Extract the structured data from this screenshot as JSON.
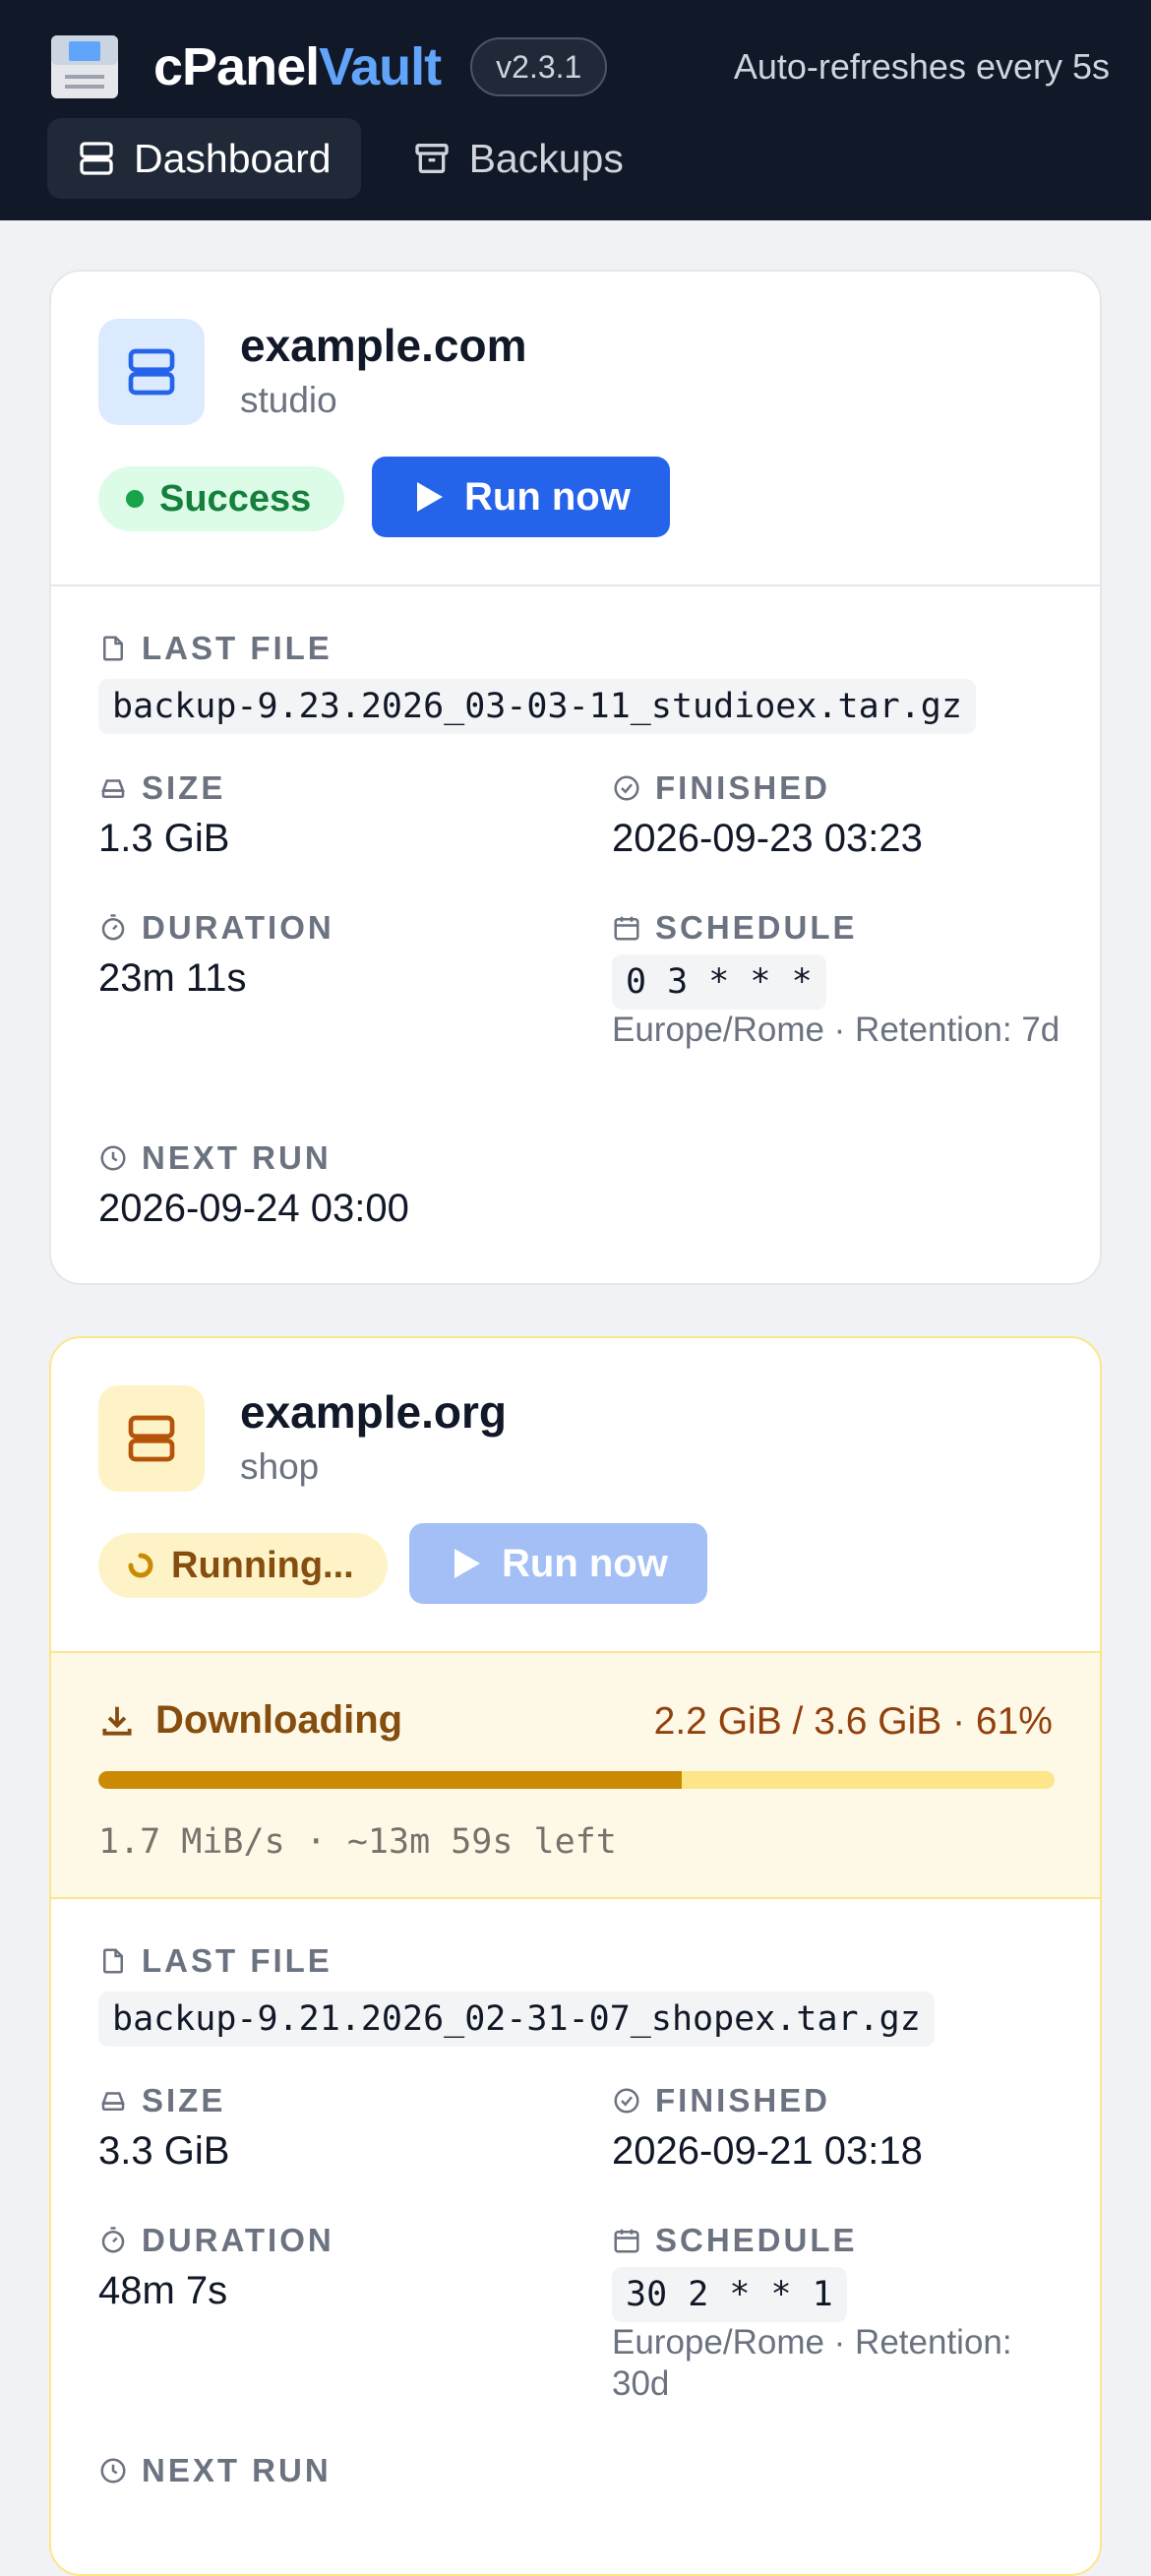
{
  "header": {
    "brand_primary": "cPanel",
    "brand_accent": "Vault",
    "version": "v2.3.1",
    "auto_refresh": "Auto-refreshes every 5s",
    "tabs": [
      {
        "label": "Dashboard",
        "icon": "server-stack-icon",
        "active": true
      },
      {
        "label": "Backups",
        "icon": "archive-box-icon",
        "active": false
      }
    ]
  },
  "labels": {
    "last_file": "LAST FILE",
    "size": "SIZE",
    "finished": "FINISHED",
    "duration": "DURATION",
    "schedule": "SCHEDULE",
    "next_run": "NEXT RUN",
    "run_now": "Run now"
  },
  "cards": [
    {
      "domain": "example.com",
      "account": "studio",
      "status": "Success",
      "status_color": "#15803d",
      "last_file": "backup-9.23.2026_03-03-11_studioex.tar.gz",
      "size": "1.3 GiB",
      "finished": "2026-09-23 03:23",
      "duration": "23m 11s",
      "schedule": "0 3 * * *",
      "schedule_note": "Europe/Rome · Retention: 7d",
      "next_run": "2026-09-24 03:00"
    },
    {
      "domain": "example.org",
      "account": "shop",
      "status": "Running...",
      "status_color": "#854d0e",
      "download": {
        "title": "Downloading",
        "stats": "2.2 GiB / 3.6 GiB · 61%",
        "progress_percent": 61,
        "rate": "1.7 MiB/s · ~13m 59s left"
      },
      "last_file": "backup-9.21.2026_02-31-07_shopex.tar.gz",
      "size": "3.3 GiB",
      "finished": "2026-09-21 03:18",
      "duration": "48m 7s",
      "schedule": "30 2 * * 1",
      "schedule_note": "Europe/Rome · Retention: 30d"
    }
  ],
  "colors": {
    "accent": "#2563eb",
    "brand_accent": "#60a5fa",
    "success": "#16a34a",
    "warning": "#ca8a04"
  }
}
